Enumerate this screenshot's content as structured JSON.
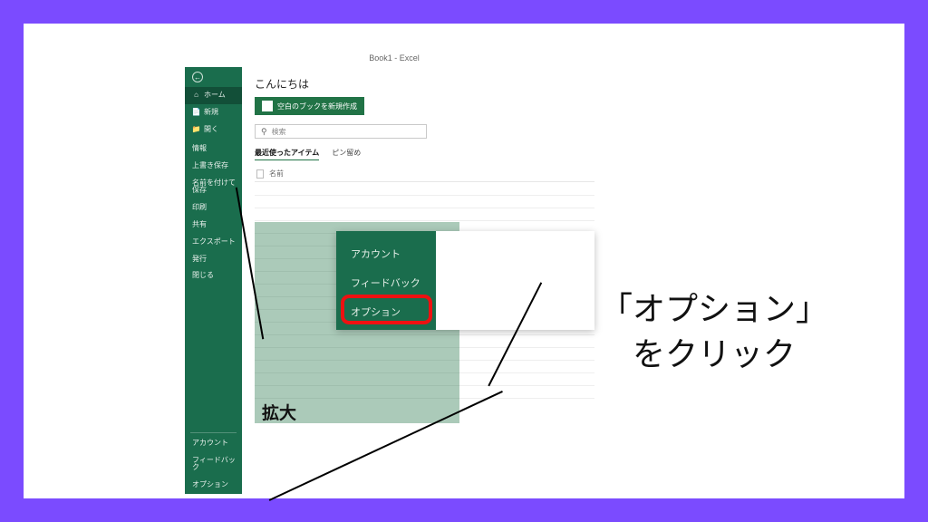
{
  "title_bar": "Book1 - Excel",
  "sidebar": {
    "home": "ホーム",
    "new": "新規",
    "open": "開く",
    "info": "情報",
    "save": "上書き保存",
    "save_as": "名前を付けて保存",
    "print": "印刷",
    "share": "共有",
    "export": "エクスポート",
    "publish": "発行",
    "close": "閉じる",
    "account": "アカウント",
    "feedback": "フィードバック",
    "options": "オプション"
  },
  "content": {
    "greeting": "こんにちは",
    "new_blank": "空白のブックを新規作成",
    "search_placeholder": "検索",
    "tab_recent": "最近使ったアイテム",
    "tab_pinned": "ピン留め",
    "col_name": "名前"
  },
  "popup": {
    "account": "アカウント",
    "feedback": "フィードバック",
    "options": "オプション"
  },
  "zoom_label": "拡大",
  "annotation": {
    "line1": "「オプション」",
    "line2": "をクリック"
  }
}
